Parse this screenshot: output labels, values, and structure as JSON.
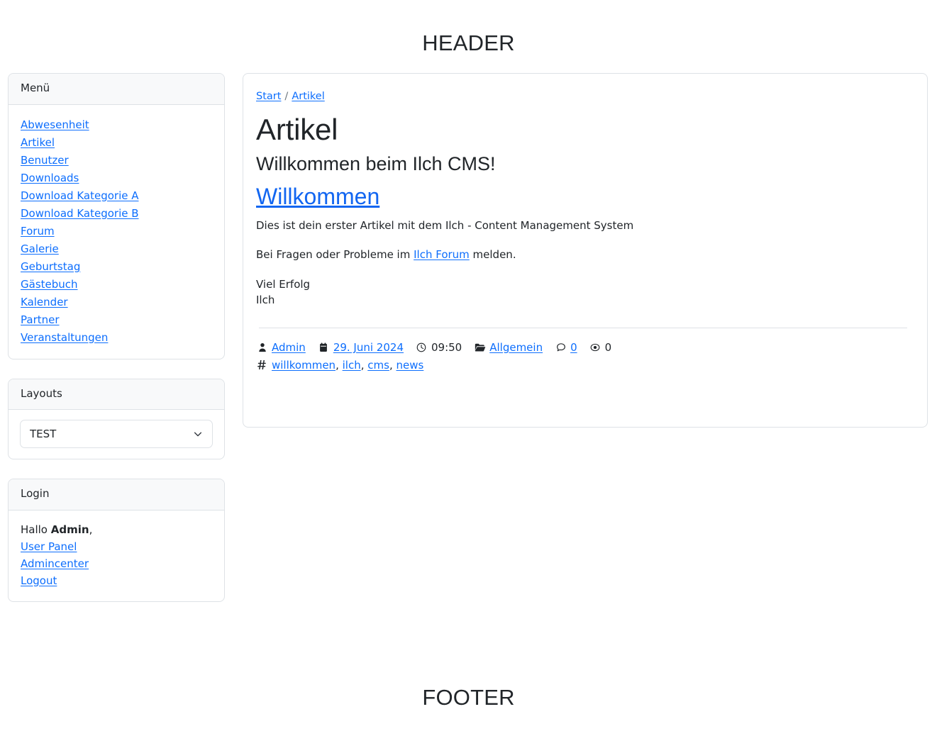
{
  "page": {
    "header_text": "HEADER",
    "footer_text": "FOOTER"
  },
  "sidebar": {
    "menu": {
      "title": "Menü",
      "items": [
        {
          "label": "Abwesenheit"
        },
        {
          "label": "Artikel"
        },
        {
          "label": "Benutzer"
        },
        {
          "label": "Downloads"
        },
        {
          "label": "Download Kategorie A"
        },
        {
          "label": "Download Kategorie B"
        },
        {
          "label": "Forum"
        },
        {
          "label": "Galerie"
        },
        {
          "label": "Geburtstag"
        },
        {
          "label": "Gästebuch"
        },
        {
          "label": "Kalender"
        },
        {
          "label": "Partner"
        },
        {
          "label": "Veranstaltungen"
        }
      ]
    },
    "layouts": {
      "title": "Layouts",
      "selected": "TEST",
      "options": [
        "TEST"
      ]
    },
    "login": {
      "title": "Login",
      "greeting_prefix": "Hallo ",
      "username": "Admin",
      "greeting_suffix": ",",
      "links": [
        {
          "label": "User Panel"
        },
        {
          "label": "Admincenter"
        },
        {
          "label": "Logout"
        }
      ]
    }
  },
  "main": {
    "breadcrumb": {
      "items": [
        {
          "label": "Start"
        },
        {
          "label": "Artikel"
        }
      ],
      "separator": "/"
    },
    "page_title": "Artikel",
    "article": {
      "subtitle": "Willkommen beim Ilch CMS!",
      "link_title": "Willkommen",
      "paragraph_1": "Dies ist dein erster Artikel mit dem Ilch - Content Management System",
      "paragraph_2_before": "Bei Fragen oder Probleme im ",
      "paragraph_2_link": "Ilch Forum",
      "paragraph_2_after": " melden.",
      "closing_line_1": "Viel Erfolg",
      "closing_line_2": "Ilch",
      "meta": {
        "author": "Admin",
        "date": "29. Juni 2024",
        "time": "09:50",
        "category": "Allgemein",
        "comments": "0",
        "views": "0",
        "icons": {
          "author": "user-icon",
          "date": "calendar-icon",
          "time": "clock-icon",
          "category": "folder-open-icon",
          "comments": "comment-icon",
          "views": "eye-icon",
          "tags": "hashtag-icon"
        }
      },
      "tags": [
        {
          "label": "willkommen"
        },
        {
          "label": "ilch"
        },
        {
          "label": "cms"
        },
        {
          "label": "news"
        }
      ],
      "tag_separator": ", "
    }
  },
  "colors": {
    "link": "#0d6efd",
    "heading_link": "#1266f1",
    "text": "#212529",
    "muted": "#6c757d",
    "border": "#dee2e6",
    "card_header_bg": "#f8f9fa",
    "background": "#ffffff"
  }
}
